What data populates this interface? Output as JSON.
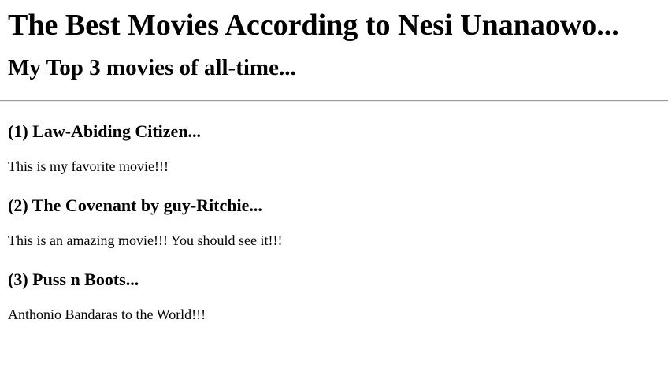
{
  "page": {
    "title": "The Best Movies According to Nesi Unanaowo...",
    "subtitle": "My Top 3 movies of all-time..."
  },
  "movies": [
    {
      "heading": "(1) Law-Abiding Citizen...",
      "description": "This is my favorite movie!!!"
    },
    {
      "heading": "(2) The Covenant by guy-Ritchie...",
      "description": "This is an amazing movie!!! You should see it!!!"
    },
    {
      "heading": "(3) Puss n Boots...",
      "description": "Anthonio Bandaras to the World!!!"
    }
  ]
}
